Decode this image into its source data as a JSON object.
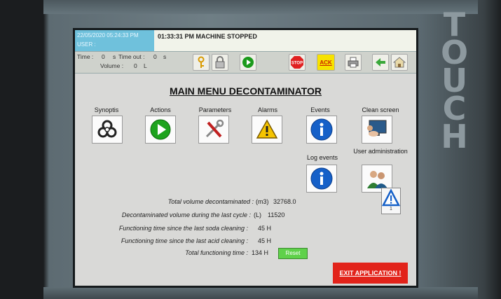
{
  "device": {
    "brand": "TOUCH"
  },
  "status": {
    "datetime": "22/05/2020 05:24:33 PM",
    "user": "USER :",
    "message": "01:33:31 PM MACHINE STOPPED"
  },
  "toolbar": {
    "time_label": "Time :",
    "time_value": "0",
    "time_unit": "s",
    "timeout_label": "Time out :",
    "timeout_value": "0",
    "timeout_unit": "s",
    "volume_label": "Volume :",
    "volume_value": "0",
    "volume_unit": "L",
    "stop_label": "STOP",
    "ack_label": "ACK"
  },
  "main": {
    "title": "MAIN MENU DECONTAMINATOR",
    "menu": [
      {
        "label": "Synoptis",
        "icon": "biohazard-icon"
      },
      {
        "label": "Actions",
        "icon": "play-icon"
      },
      {
        "label": "Parameters",
        "icon": "tools-icon"
      },
      {
        "label": "Alarms",
        "icon": "warning-icon"
      },
      {
        "label": "Events",
        "icon": "info-icon"
      },
      {
        "label": "Clean screen",
        "icon": "clean-screen-icon"
      },
      {
        "label": "Log events",
        "icon": "info-icon"
      },
      {
        "label": "User administration",
        "icon": "users-icon"
      }
    ],
    "info": [
      {
        "label": "Total volume decontaminated :",
        "unit": "(m3)",
        "value": "32768.0"
      },
      {
        "label": "Decontaminated volume during the last cycle :",
        "unit": "(L)",
        "value": "11520"
      },
      {
        "label": "Functioning time since the last soda cleaning :",
        "unit": "",
        "value": "45 H"
      },
      {
        "label": "Functioning time since the last acid cleaning :",
        "unit": "",
        "value": "45 H"
      },
      {
        "label": "Total functioning time :",
        "unit": "",
        "value": "134 H"
      }
    ],
    "reset_label": "Reset",
    "exit_label": "EXIT APPLICATION !",
    "warning_badge": "1"
  },
  "colors": {
    "datetime_bg": "#6fc1dc",
    "exit_bg": "#e2231a",
    "reset_bg": "#5fd14a",
    "info_blue": "#1560c8",
    "stop_red": "#e02020",
    "ack_yellow": "#f7e200"
  }
}
